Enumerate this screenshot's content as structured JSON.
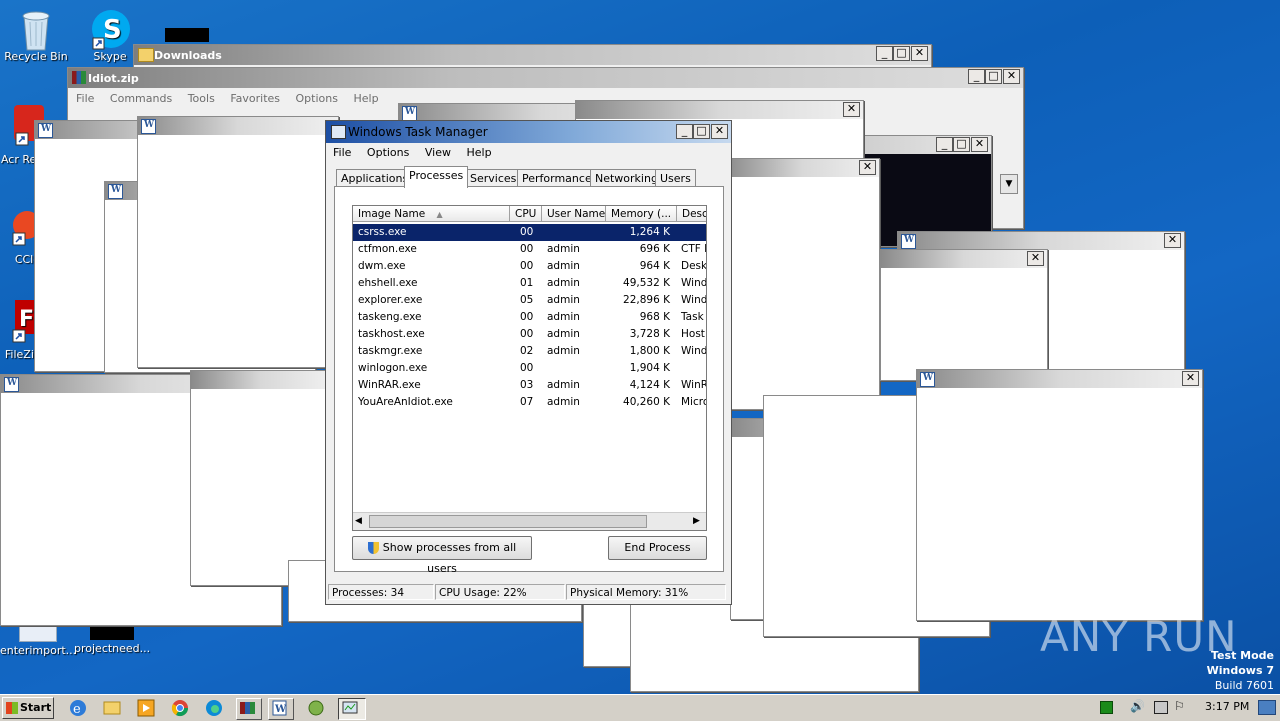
{
  "desktop": {
    "icons": [
      {
        "label": "Recycle Bin",
        "icon": "recycle-bin-icon"
      },
      {
        "label": "Skype",
        "icon": "skype-icon"
      },
      {
        "label": "Acr Read",
        "icon": "acrobat-icon"
      },
      {
        "label": "CCle",
        "icon": "ccleaner-icon"
      },
      {
        "label": "FileZill",
        "icon": "filezilla-icon"
      },
      {
        "label": "enterimport...",
        "icon": "file-icon"
      },
      {
        "label": "projectneed...",
        "icon": "file-icon"
      }
    ],
    "watermark": "ANY RUN",
    "test_mode": {
      "line1": "Test Mode",
      "line2": "Windows 7",
      "line3": "Build 7601"
    }
  },
  "windows": {
    "downloads_title": "Downloads",
    "winrar": {
      "title": "Idiot.zip",
      "menu": [
        "File",
        "Commands",
        "Tools",
        "Favorites",
        "Options",
        "Help"
      ]
    }
  },
  "taskmgr": {
    "title": "Windows Task Manager",
    "menu": [
      "File",
      "Options",
      "View",
      "Help"
    ],
    "tabs": [
      "Applications",
      "Processes",
      "Services",
      "Performance",
      "Networking",
      "Users"
    ],
    "active_tab": "Processes",
    "columns": [
      "Image Name",
      "CPU",
      "User Name",
      "Memory (...",
      "Desc"
    ],
    "rows": [
      {
        "name": "csrss.exe",
        "cpu": "00",
        "user": "",
        "mem": "1,264 K",
        "desc": "",
        "selected": true
      },
      {
        "name": "ctfmon.exe",
        "cpu": "00",
        "user": "admin",
        "mem": "696 K",
        "desc": "CTF I"
      },
      {
        "name": "dwm.exe",
        "cpu": "00",
        "user": "admin",
        "mem": "964 K",
        "desc": "Desk"
      },
      {
        "name": "ehshell.exe",
        "cpu": "01",
        "user": "admin",
        "mem": "49,532 K",
        "desc": "Wind"
      },
      {
        "name": "explorer.exe",
        "cpu": "05",
        "user": "admin",
        "mem": "22,896 K",
        "desc": "Wind"
      },
      {
        "name": "taskeng.exe",
        "cpu": "00",
        "user": "admin",
        "mem": "968 K",
        "desc": "Task"
      },
      {
        "name": "taskhost.exe",
        "cpu": "00",
        "user": "admin",
        "mem": "3,728 K",
        "desc": "Host"
      },
      {
        "name": "taskmgr.exe",
        "cpu": "02",
        "user": "admin",
        "mem": "1,800 K",
        "desc": "Wind"
      },
      {
        "name": "winlogon.exe",
        "cpu": "00",
        "user": "",
        "mem": "1,904 K",
        "desc": ""
      },
      {
        "name": "WinRAR.exe",
        "cpu": "03",
        "user": "admin",
        "mem": "4,124 K",
        "desc": "WinR"
      },
      {
        "name": "YouAreAnIdiot.exe",
        "cpu": "07",
        "user": "admin",
        "mem": "40,260 K",
        "desc": "Micro"
      }
    ],
    "show_all_label": "Show processes from all users",
    "end_process_label": "End Process",
    "status": {
      "processes": "Processes: 34",
      "cpu": "CPU Usage: 22%",
      "memory": "Physical Memory: 31%"
    }
  },
  "taskbar": {
    "start_label": "Start",
    "clock": "3:17 PM"
  }
}
